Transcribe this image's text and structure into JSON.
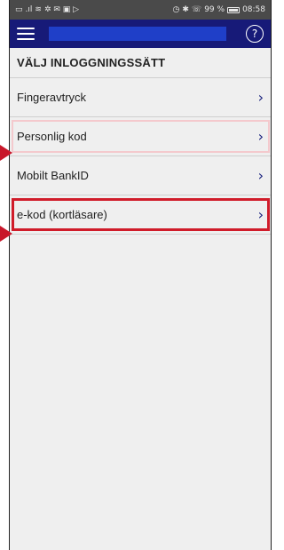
{
  "statusbar": {
    "left_icons": [
      "sim-icon",
      "signal-icon",
      "wifi-icon",
      "notification-icons"
    ],
    "right_text": "99 %",
    "time": "08:58"
  },
  "appbar": {
    "menu_icon": "hamburger-menu-icon",
    "help_icon": "help-icon",
    "help_glyph": "?",
    "bg_color": "#171a78"
  },
  "section": {
    "title": "VÄLJ INLOGGNINGSSÄTT"
  },
  "login_methods": [
    {
      "label": "Fingeravtryck",
      "chevron": "›"
    },
    {
      "label": "Personlig kod",
      "chevron": "›"
    },
    {
      "label": "Mobilt BankID",
      "chevron": "›"
    },
    {
      "label": "e-kod (kortläsare)",
      "chevron": "›"
    }
  ],
  "annotations": {
    "highlight_color": "#d01c2a",
    "arrow_color": "#c8172a"
  }
}
